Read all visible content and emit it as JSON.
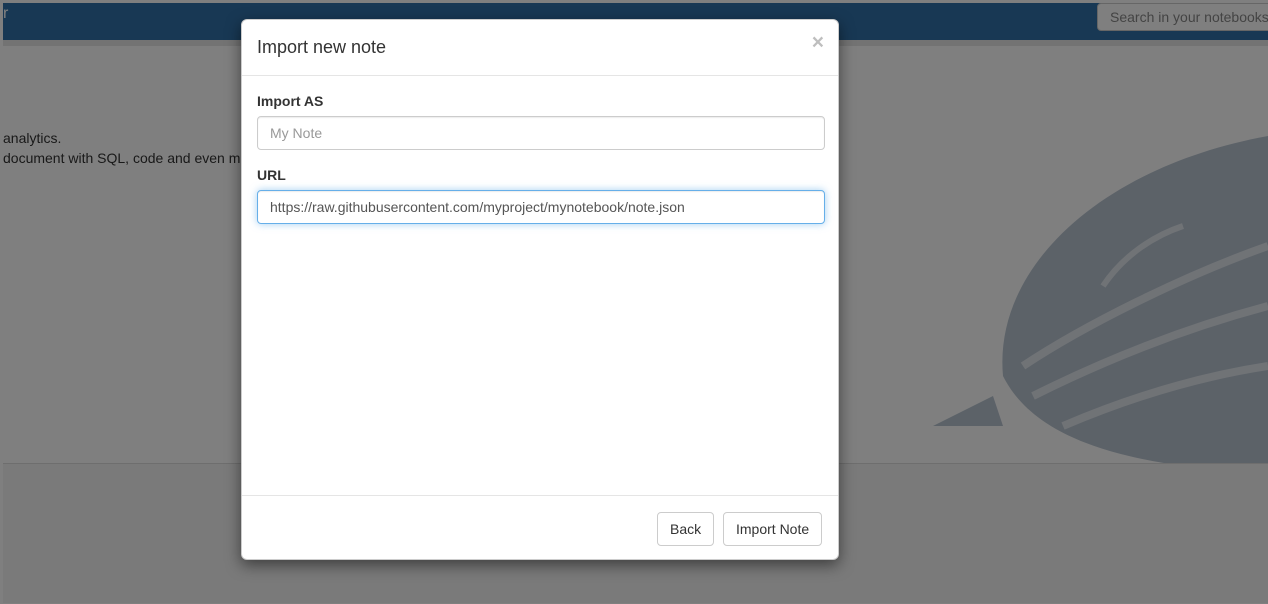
{
  "navbar": {
    "brand_fragment": "r",
    "search_placeholder": "Search in your notebooks"
  },
  "background": {
    "lines": [
      "analytics.",
      "document with SQL, code and even m"
    ]
  },
  "modal": {
    "title": "Import new note",
    "close_glyph": "×",
    "import_as_label": "Import AS",
    "import_as_placeholder": "My Note",
    "import_as_value": "",
    "url_label": "URL",
    "url_value": "https://raw.githubusercontent.com/myproject/mynotebook/note.json",
    "back_label": "Back",
    "import_label": "Import Note"
  },
  "icons": [
    "close-icon",
    "zeppelin-logo"
  ]
}
